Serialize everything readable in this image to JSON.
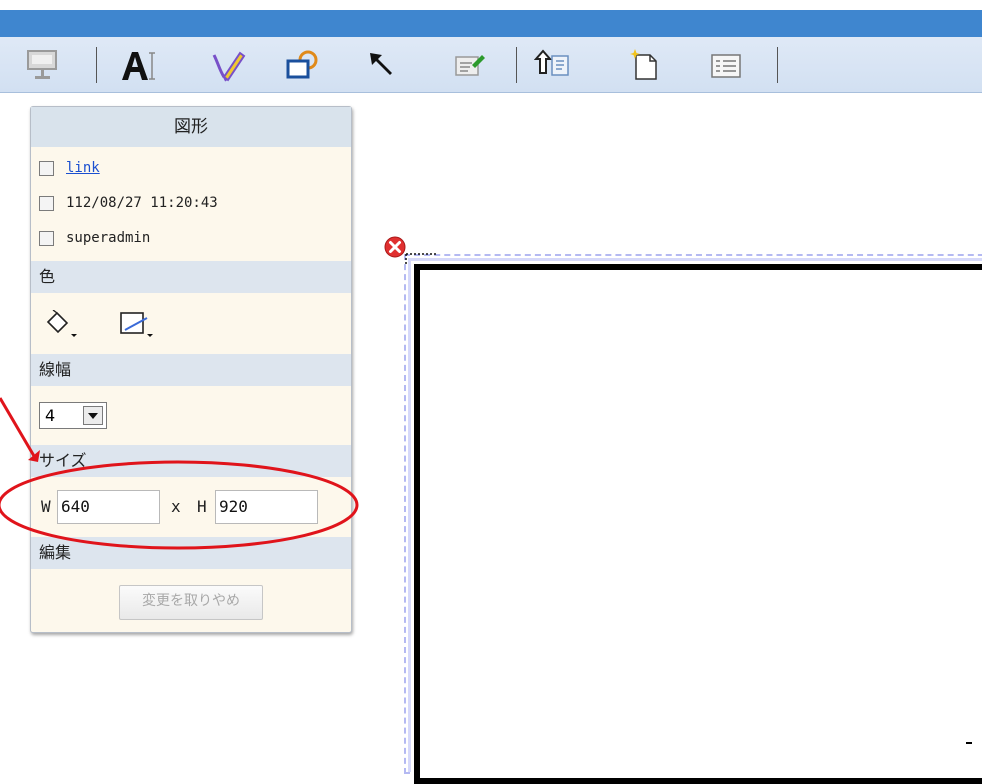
{
  "panel": {
    "title": "図形",
    "checks": [
      {
        "label": "link",
        "is_link": true
      },
      {
        "label": "112/08/27 11:20:43"
      },
      {
        "label": "superadmin"
      }
    ],
    "color_section": "色",
    "line_width_section": "線幅",
    "line_width_value": "4",
    "size_section": "サイズ",
    "size": {
      "w_label": "W",
      "w_value": "640",
      "x_label": "x",
      "h_label": "H",
      "h_value": "920"
    },
    "edit_section": "編集",
    "cancel_button": "変更を取りやめ"
  },
  "toolbar": {
    "icons": [
      "presentation-icon",
      "text-tool-icon",
      "pen-tool-icon",
      "shape-tool-icon",
      "select-arrow-icon",
      "note-edit-icon",
      "upload-icon",
      "new-page-icon",
      "list-icon"
    ]
  },
  "colors": {
    "titlebar": "#3f86cf",
    "toolbar": "#d8e4f3",
    "panel": "#fdf8ec",
    "annotation": "#e0141b"
  }
}
